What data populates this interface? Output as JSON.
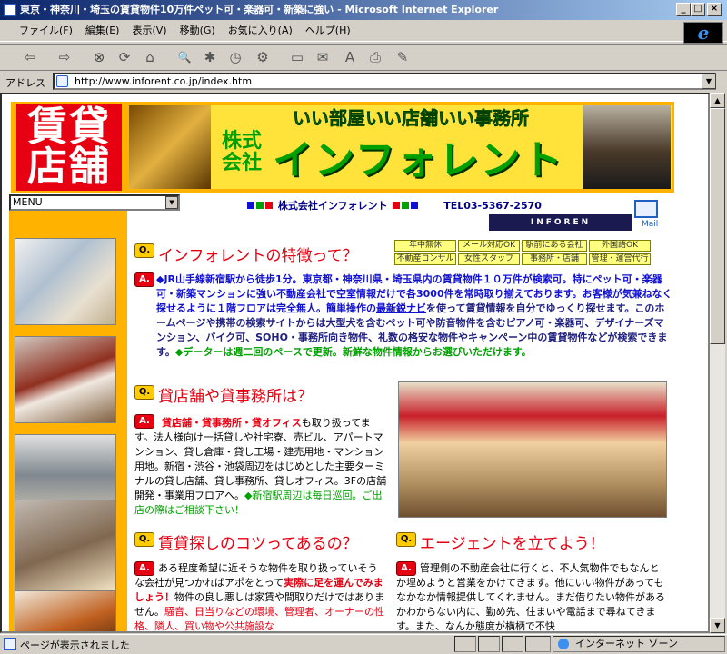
{
  "window": {
    "title": "東京・神奈川・埼玉の賃貸物件10万件ペット可・楽器可・新築に強い - Microsoft Internet Explorer",
    "minimize": "_",
    "maximize": "□",
    "close": "×"
  },
  "menubar": {
    "items": [
      "ファイル(F)",
      "編集(E)",
      "表示(V)",
      "移動(G)",
      "お気に入り(A)",
      "ヘルプ(H)"
    ]
  },
  "toolbar": {
    "back": "⇦",
    "forward": "⇨",
    "stop": "⊗",
    "refresh": "⟳",
    "home": "⌂",
    "search": "🔍",
    "favorites": "✱",
    "history": "◷",
    "channels": "⚙",
    "fullscreen": "▭",
    "mail": "✉",
    "font": "A",
    "print": "⎙",
    "edit": "✎"
  },
  "address": {
    "label": "アドレス",
    "url": "http://www.inforent.co.jp/index.htm"
  },
  "page": {
    "banner": {
      "chintai": "賃貸店舗",
      "tagline": "いい部屋いい店舗いい事務所",
      "kabu": "株式会社",
      "company": "インフォレント"
    },
    "menu_select": "MENU",
    "info": {
      "company_name": "株式会社インフォレント",
      "tel": "TEL03-5367-2570",
      "mail_label": "Mail",
      "train_text": "INFOREN"
    },
    "tags": [
      "年中無休",
      "メール対応OK",
      "駅前にある会社",
      "外国語OK",
      "不動産コンサル",
      "女性スタッフ",
      "事務所・店舗",
      "管理・運営代行"
    ],
    "q_label": "Q.",
    "a_label": "A.",
    "section1": {
      "heading": "インフォレントの特徴って？",
      "lead": "◆JR山手線新宿駅から徒歩1分。東京都・神奈川県・埼玉県内の賃貸物件１０万件が検索可。特にペット可・楽器可・新築マンションに強い不動産会社で空室情報だけで各3000件を常時取り揃えております。お客様が気兼ねなく探せるように１階フロアは完全無人。簡単操作の",
      "link": "最新鋭ナビ",
      "rest": "を使って賃貸情報を自分でゆっくり探せます。このホームページや携帯の検索サイトからは大型犬を含むペット可や防音物件を含むピアノ可・楽器可、デザイナーズマンション、バイク可、SOHO・事務所向き物件、礼数の格安な物件やキャンペーン中の賃貸物件などが検索できます。",
      "green": "◆データーは週二回のペースで更新。新鮮な物件情報からお選びいただけます。"
    },
    "section2": {
      "heading": "貸店舗や貸事務所は？",
      "lead": "貸店舗・貸事務所・貸オフィス",
      "rest": "も取り扱ってます。法人様向け一括貸しや社宅寮、売ビル、アパートマンション、貸し倉庫・貸し工場・建売用地・マンション用地。新宿・渋谷・池袋周辺をはじめとした主要ターミナルの貸し店舗、貸し事務所、貸しオフィス。3Fの店舗開発・事業用フロアへ。",
      "green": "◆新宿駅周辺は毎日巡回。ご出店の際はご相談下さい！"
    },
    "section3": {
      "heading": "賃貸探しのコツってあるの？",
      "text1": "ある程度希望に近そうな物件を取り扱っていそうな会社が見つかればアポをとって",
      "red1": "実際に足を運んでみましょう！",
      "text2": "物件の良し悪しは家賃や間取りだけではありません。",
      "red2": "騒音、日当りなどの環境、管理者、オーナーの性格、隣人、買い物や公共施設な"
    },
    "section4": {
      "heading": "エージェントを立てよう！",
      "text": "管理側の不動産会社に行くと、不人気物件でもなんとか埋めようと営業をかけてきます。他にいい物件があってもなかなか情報提供してくれません。まだ借りたい物件があるかわからない内に、勤め先、住まいや電話まで尋ねてきます。また、なんか態度が横柄で不快"
    }
  },
  "status": {
    "text": "ページが表示されました",
    "zone": "インターネット ゾーン"
  }
}
